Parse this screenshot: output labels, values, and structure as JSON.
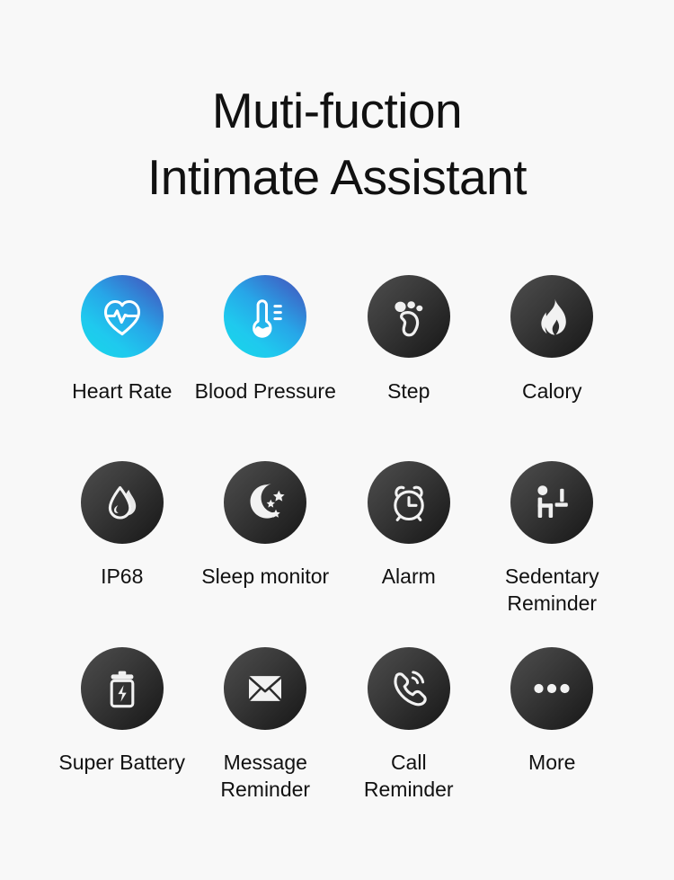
{
  "page": {
    "background_color": "#f8f8f8",
    "text_color": "#111111"
  },
  "heading": {
    "line1": "Muti-fuction",
    "line2": "Intimate Assistant"
  },
  "colors": {
    "dark_badge_from": "#4e4e4e",
    "dark_badge_to": "#161616",
    "blue_badge_from": "#17d7e8",
    "blue_badge_to": "#4a56b4",
    "icon_glyph": "#ffffff"
  },
  "features": {
    "rows": [
      {
        "items": [
          {
            "label": "Heart Rate",
            "icon": "heart-rate-icon",
            "badge_style": "blue"
          },
          {
            "label": "Blood Pressure",
            "icon": "thermometer-icon",
            "badge_style": "blue"
          },
          {
            "label": "Step",
            "icon": "footprint-icon",
            "badge_style": "dark"
          },
          {
            "label": "Calory",
            "icon": "flame-icon",
            "badge_style": "dark"
          }
        ]
      },
      {
        "items": [
          {
            "label": "IP68",
            "icon": "water-drop-icon",
            "badge_style": "dark"
          },
          {
            "label": "Sleep monitor",
            "icon": "moon-stars-icon",
            "badge_style": "dark"
          },
          {
            "label": "Alarm",
            "icon": "alarm-clock-icon",
            "badge_style": "dark"
          },
          {
            "label": "Sedentary\nReminder",
            "icon": "sedentary-person-icon",
            "badge_style": "dark"
          }
        ]
      },
      {
        "items": [
          {
            "label": "Super Battery",
            "icon": "battery-charging-icon",
            "badge_style": "dark"
          },
          {
            "label": "Message\nReminder",
            "icon": "envelope-icon",
            "badge_style": "dark"
          },
          {
            "label": "Call\nReminder",
            "icon": "phone-handset-icon",
            "badge_style": "dark"
          },
          {
            "label": "More",
            "icon": "ellipsis-icon",
            "badge_style": "dark"
          }
        ]
      }
    ]
  }
}
